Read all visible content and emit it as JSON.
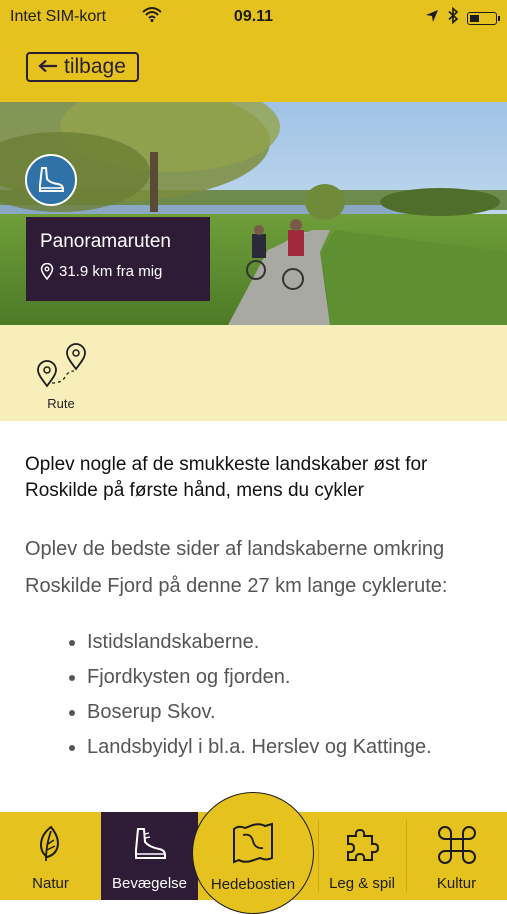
{
  "status_bar": {
    "carrier": "Intet SIM-kort",
    "time": "09.11",
    "icons": [
      "wifi-icon",
      "location-arrow-icon",
      "bluetooth-icon",
      "battery-icon"
    ]
  },
  "nav": {
    "back_label": "tilbage",
    "back_icon": "arrow-left-icon"
  },
  "hero": {
    "activity_icon": "shoe-icon",
    "title": "Panoramaruten",
    "distance": "31.9 km fra mig",
    "distance_icon": "map-pin-icon"
  },
  "info": {
    "route_label": "Rute",
    "route_icon": "route-pins-icon"
  },
  "content": {
    "headline": "Oplev nogle af de smukkeste landskaber øst for Roskilde på første hånd, mens du cykler",
    "intro": "Oplev de bedste sider af landskaberne omkring Roskilde Fjord på denne 27 km lange cyklerute:",
    "bullets": [
      "Istidslandskaberne.",
      "Fjordkysten og fjorden.",
      "Boserup Skov.",
      "Landsbyidyl i bl.a. Herslev og Kattinge."
    ]
  },
  "tabs": [
    {
      "label": "Natur",
      "icon": "leaf-icon",
      "active": false
    },
    {
      "label": "Bevægelse",
      "icon": "shoe-icon",
      "active": true
    },
    {
      "label": "Hedebostien",
      "icon": "map-icon",
      "active": false
    },
    {
      "label": "Leg & spil",
      "icon": "puzzle-icon",
      "active": false
    },
    {
      "label": "Kultur",
      "icon": "command-icon",
      "active": false
    }
  ],
  "colors": {
    "brand_yellow": "#e6c21f",
    "dark_purple": "#2e1c36",
    "light_yellow": "#f7eeba",
    "badge_blue": "#2e72a8"
  }
}
